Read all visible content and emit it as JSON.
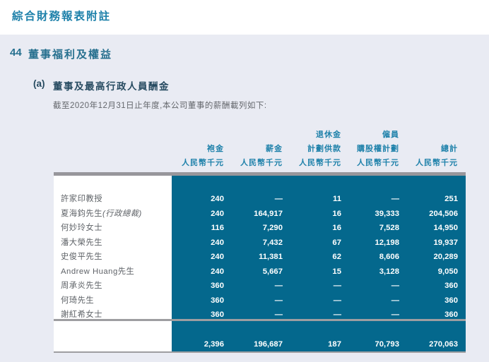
{
  "doc": {
    "title": "綜合財務報表附註"
  },
  "section": {
    "number": "44",
    "title": "董事福利及權益"
  },
  "subsection": {
    "label": "(a)",
    "title": "董事及最高行政人員酬金",
    "intro": "截至2020年12月31日止年度,本公司董事的薪酬載列如下:"
  },
  "colors": {
    "accent_teal": "#1e81aa",
    "section_heading": "#27708f",
    "subsection_heading": "#264a60",
    "table_fill_teal": "#04688d",
    "page_background": "#e9ebf3",
    "rule_gray": "#97969b"
  },
  "table": {
    "columns": [
      {
        "line1": "",
        "label": "袍金",
        "unit": "人民幣千元"
      },
      {
        "line1": "",
        "label": "薪金",
        "unit": "人民幣千元"
      },
      {
        "line1": "退休金",
        "label": "計劃供款",
        "unit": "人民幣千元"
      },
      {
        "line1": "僱員",
        "label": "購股權計劃",
        "unit": "人民幣千元"
      },
      {
        "line1": "",
        "label": "總計",
        "unit": "人民幣千元"
      }
    ],
    "rows": [
      {
        "name": "許家印教授",
        "values": [
          "240",
          "—",
          "11",
          "—",
          "251"
        ]
      },
      {
        "name": "夏海鈞先生",
        "name_suffix_italic": "(行政總裁)",
        "values": [
          "240",
          "164,917",
          "16",
          "39,333",
          "204,506"
        ]
      },
      {
        "name": "何妙玲女士",
        "values": [
          "116",
          "7,290",
          "16",
          "7,528",
          "14,950"
        ]
      },
      {
        "name": "潘大榮先生",
        "values": [
          "240",
          "7,432",
          "67",
          "12,198",
          "19,937"
        ]
      },
      {
        "name": "史俊平先生",
        "values": [
          "240",
          "11,381",
          "62",
          "8,606",
          "20,289"
        ]
      },
      {
        "name": "Andrew Huang先生",
        "values": [
          "240",
          "5,667",
          "15",
          "3,128",
          "9,050"
        ]
      },
      {
        "name": "周承炎先生",
        "values": [
          "360",
          "—",
          "—",
          "—",
          "360"
        ]
      },
      {
        "name": "何琦先生",
        "values": [
          "360",
          "—",
          "—",
          "—",
          "360"
        ]
      },
      {
        "name": "謝紅希女士",
        "values": [
          "360",
          "—",
          "—",
          "—",
          "360"
        ]
      }
    ],
    "total": {
      "values": [
        "2,396",
        "196,687",
        "187",
        "70,793",
        "270,063"
      ]
    }
  }
}
